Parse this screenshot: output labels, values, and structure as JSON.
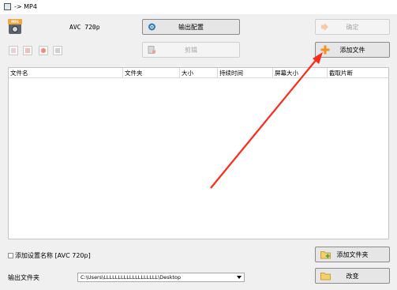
{
  "window": {
    "title": "-> MP4"
  },
  "preset": {
    "label": "AVC 720p",
    "icon": "mp4-format-icon"
  },
  "buttons": {
    "output_config": "输出配置",
    "edit": "剪辑",
    "ok": "确定",
    "add_file": "添加文件",
    "add_folder": "添加文件夹",
    "change": "改变"
  },
  "toolbar": {
    "icons": [
      "remove-file-icon",
      "clear-list-icon",
      "stop-icon",
      "media-info-icon"
    ]
  },
  "file_list": {
    "columns": [
      "文件名",
      "文件夹",
      "大小",
      "持续时间",
      "屏幕大小",
      "截取片断"
    ],
    "rows": []
  },
  "options": {
    "add_preset_name_label": "添加设置名称 [AVC 720p]",
    "add_preset_name_checked": false
  },
  "output": {
    "label": "输出文件夹",
    "path": "C:\\Users\\LLLLLLLLLLLLLLLLLLL\\Desktop"
  },
  "colors": {
    "annotation_arrow": "#ff2a1a",
    "add_icon": "#f5901e"
  }
}
